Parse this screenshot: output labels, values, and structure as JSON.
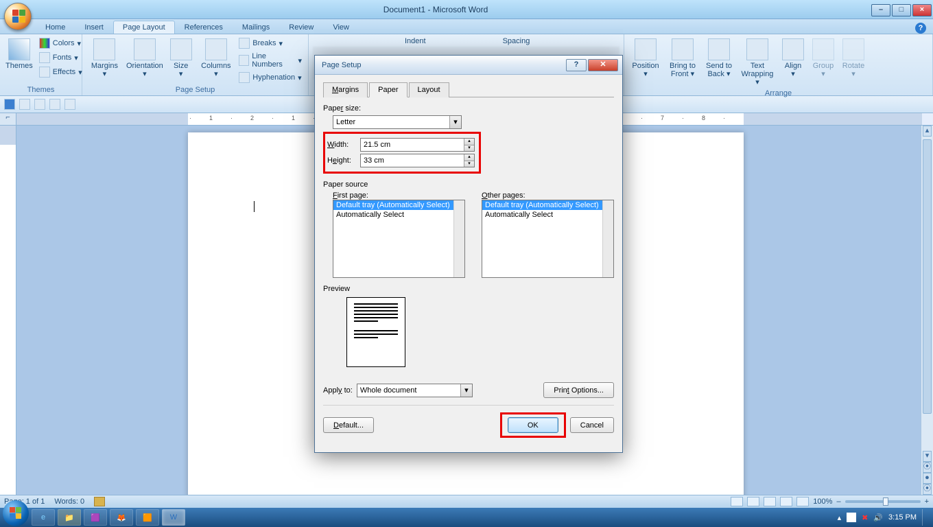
{
  "window": {
    "title": "Document1 - Microsoft Word"
  },
  "tabs": [
    "Home",
    "Insert",
    "Page Layout",
    "References",
    "Mailings",
    "Review",
    "View"
  ],
  "tabs_active_index": 2,
  "ribbon": {
    "themes": {
      "label": "Themes",
      "big": "Themes",
      "items": [
        "Colors",
        "Fonts",
        "Effects"
      ]
    },
    "pagesetup": {
      "label": "Page Setup",
      "big": [
        "Margins",
        "Orientation",
        "Size",
        "Columns"
      ],
      "items": [
        "Breaks",
        "Line Numbers",
        "Hyphenation"
      ]
    },
    "indent_label": "Indent",
    "spacing_label": "Spacing",
    "arrange": {
      "label": "Arrange",
      "big": [
        "Position",
        "Bring to Front",
        "Send to Back",
        "Text Wrapping",
        "Align",
        "Group",
        "Rotate"
      ]
    }
  },
  "dialog": {
    "title": "Page Setup",
    "tabs": [
      "Margins",
      "Paper",
      "Layout"
    ],
    "tabs_active_index": 1,
    "paper_size_label": "Paper size:",
    "paper_size_value": "Letter",
    "width_label": "Width:",
    "width_value": "21.5 cm",
    "height_label": "Height:",
    "height_value": "33 cm",
    "paper_source_label": "Paper source",
    "first_page_label": "First page:",
    "other_pages_label": "Other pages:",
    "tray_options": [
      "Default tray (Automatically Select)",
      "Automatically Select"
    ],
    "preview_label": "Preview",
    "apply_to_label": "Apply to:",
    "apply_to_value": "Whole document",
    "print_options": "Print Options...",
    "default_btn": "Default...",
    "ok": "OK",
    "cancel": "Cancel"
  },
  "status": {
    "page": "Page: 1 of 1",
    "words": "Words: 0",
    "zoom": "100%"
  },
  "tray": {
    "time": "3:15 PM"
  }
}
